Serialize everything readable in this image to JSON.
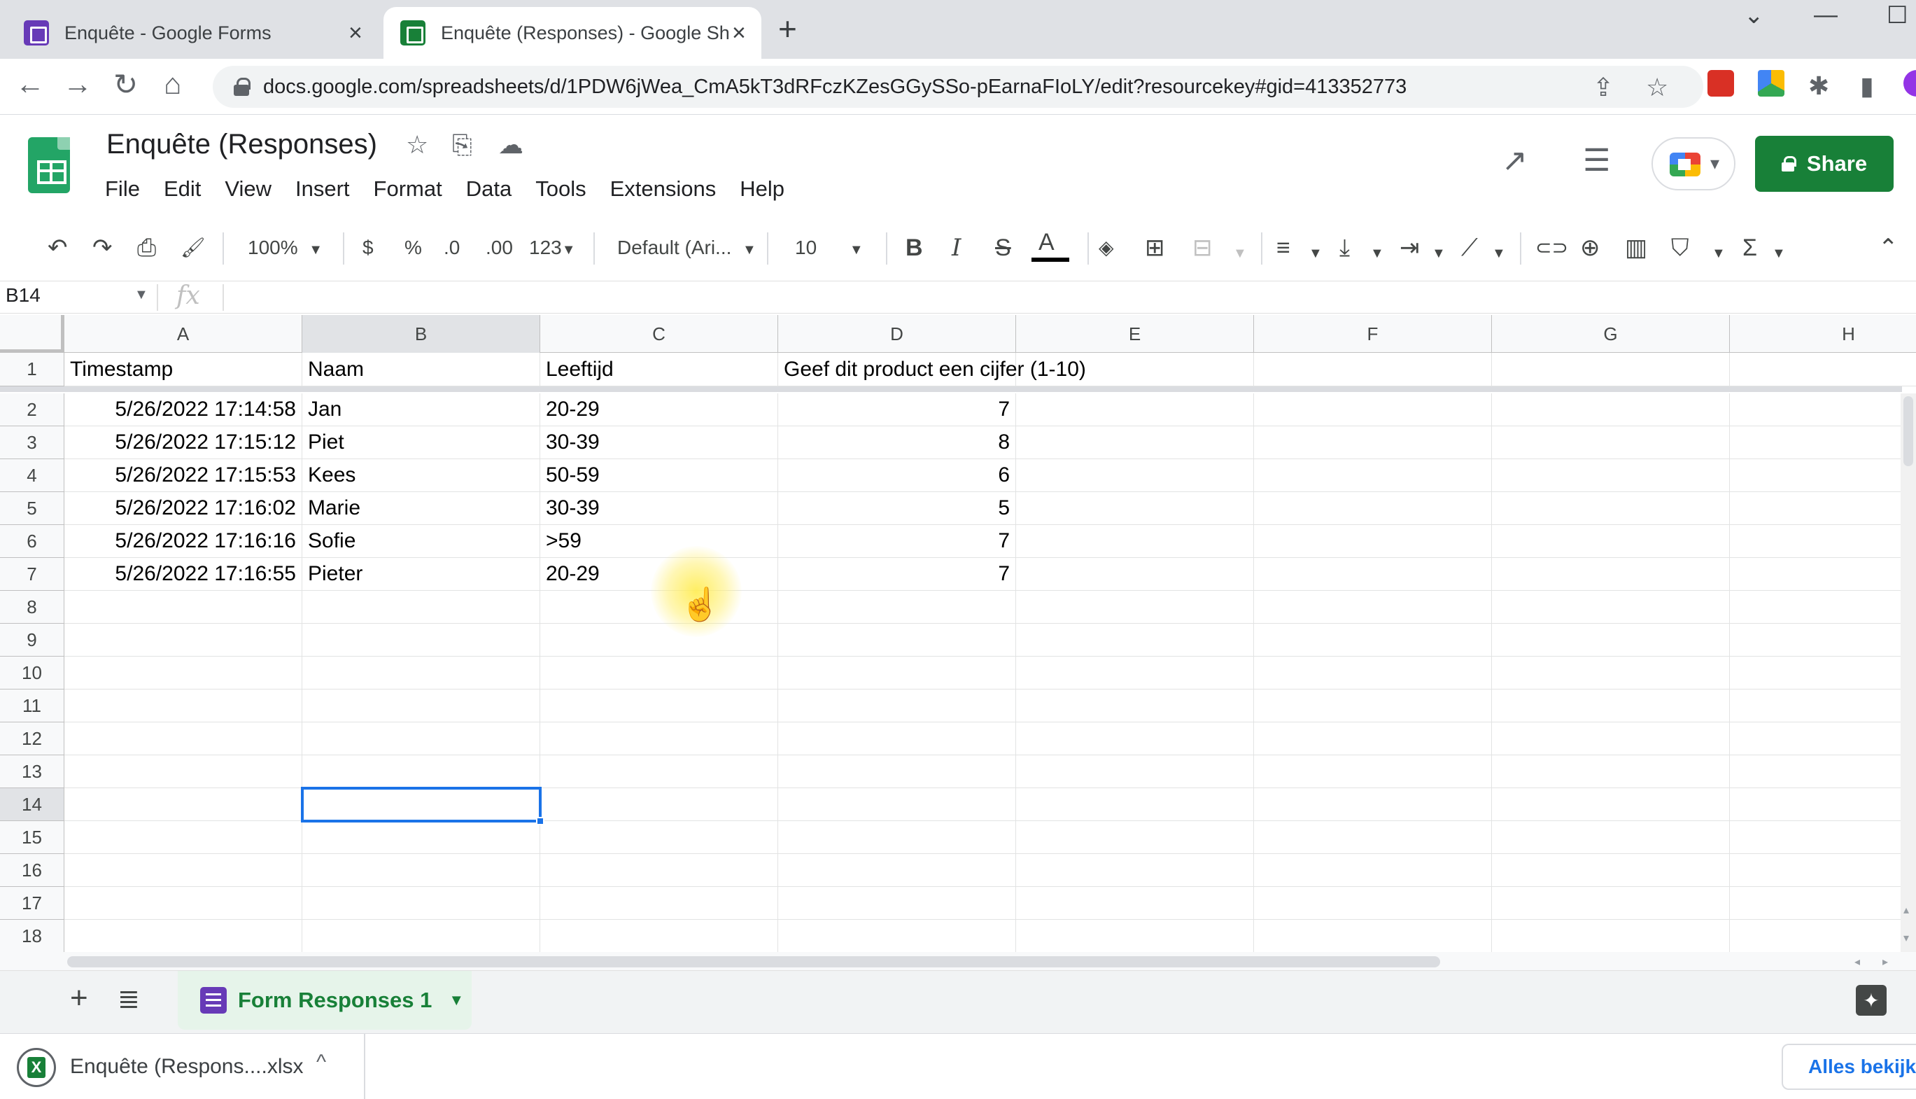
{
  "browser": {
    "tabs": [
      {
        "title": "Enquête - Google Forms"
      },
      {
        "title": "Enquête (Responses) - Google Sh"
      }
    ],
    "new_tab_glyph": "+",
    "url": "docs.google.com/spreadsheets/d/1PDW6jWea_CmA5kT3dRFczKZesGGySSo-pEarnaFIoLY/edit?resourcekey#gid=413352773",
    "icons": {
      "back": "←",
      "forward": "→",
      "reload": "↻",
      "home": "⌂",
      "share": "⇪",
      "star": "☆",
      "extensions": "✱",
      "sidepanel": "▮"
    },
    "window_controls": {
      "dropdown": "⌄",
      "minimize": "—",
      "maximize": "☐"
    }
  },
  "sheets": {
    "doc_title": "Enquête (Responses)",
    "menu": [
      "File",
      "Edit",
      "View",
      "Insert",
      "Format",
      "Data",
      "Tools",
      "Extensions",
      "Help"
    ],
    "share_label": "Share",
    "header_icons": {
      "star": "☆",
      "move": "⎘",
      "cloud": "☁",
      "activity": "↗",
      "comments": "☰"
    },
    "toolbar": {
      "undo": "↶",
      "redo": "↷",
      "print": "⎙",
      "paint_format": "🖌",
      "zoom": "100%",
      "currency": "$",
      "percent": "%",
      "decrease_decimal": ".0",
      "increase_decimal": ".00",
      "more_formats": "123",
      "font": "Default (Ari...",
      "font_size": "10",
      "bold": "B",
      "italic": "I",
      "strikethrough": "S",
      "text_color": "A",
      "fill_color": "◈",
      "borders": "⊞",
      "merge": "⊟",
      "h_align": "≡",
      "v_align": "⤓",
      "wrap": "⇥",
      "rotate": "⟋",
      "link": "⊂⊃",
      "comment": "⊕",
      "chart": "▥",
      "filter": "⛉",
      "functions": "Σ",
      "collapse": "⌃"
    },
    "name_box": "B14",
    "fx": "fx",
    "columns": [
      "A",
      "B",
      "C",
      "D",
      "E",
      "F",
      "G",
      "H"
    ],
    "selected_column": "B",
    "rows": [
      "1",
      "2",
      "3",
      "4",
      "5",
      "6",
      "7",
      "8",
      "9",
      "10",
      "11",
      "12",
      "13",
      "14",
      "15",
      "16",
      "17",
      "18"
    ],
    "selected_row": "14",
    "header_row": [
      "Timestamp",
      "Naam",
      "Leeftijd",
      "Geef dit product een cijfer (1-10)"
    ],
    "data_rows": [
      [
        "5/26/2022 17:14:58",
        "Jan",
        "20-29",
        "7"
      ],
      [
        "5/26/2022 17:15:12",
        "Piet",
        "30-39",
        "8"
      ],
      [
        "5/26/2022 17:15:53",
        "Kees",
        "50-59",
        "6"
      ],
      [
        "5/26/2022 17:16:02",
        "Marie",
        "30-39",
        "5"
      ],
      [
        "5/26/2022 17:16:16",
        "Sofie",
        ">59",
        "7"
      ],
      [
        "5/26/2022 17:16:55",
        "Pieter",
        "20-29",
        "7"
      ]
    ],
    "sheet_tab": "Form Responses 1",
    "add_sheet": "+",
    "all_sheets": "≣",
    "explore": "✦"
  },
  "download": {
    "file_name": "Enquête (Respons....xlsx",
    "caret": "^",
    "show_all": "Alles bekijken"
  },
  "colors": {
    "accent_green": "#188038",
    "selection_blue": "#1a73e8",
    "forms_purple": "#673ab7"
  }
}
